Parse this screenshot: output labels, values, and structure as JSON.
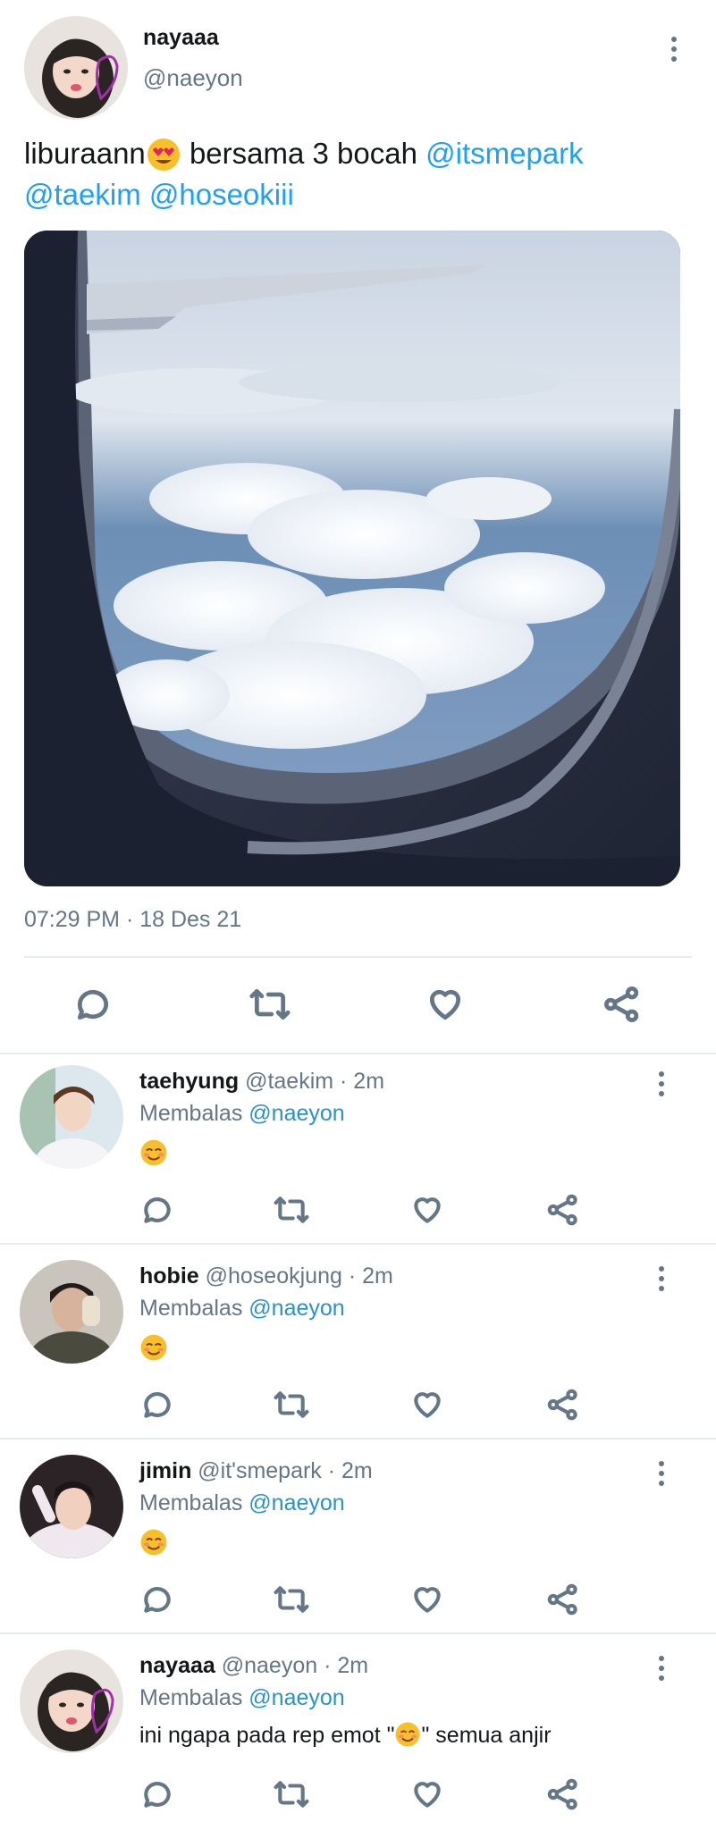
{
  "tweet": {
    "display_name": "nayaaa",
    "handle": "@naeyon",
    "text_plain": "liburaann",
    "text_after_emoji": " bersama 3 bocah ",
    "mention_1": "@itsmepark",
    "mention_2": "@taekim",
    "mention_3": "@hoseokiii",
    "timestamp": "07:29 PM · 18 Des 21",
    "avatar_icon": "profile-photo-nayaaa",
    "media_description_icon": "airplane-window-photo"
  },
  "actions": {
    "reply_icon": "reply-icon",
    "retweet_icon": "retweet-icon",
    "like_icon": "heart-icon",
    "share_icon": "share-icon"
  },
  "replies": [
    {
      "display_name": "taehyung",
      "meta": "@taekim · 2m",
      "replying_label": "Membalas",
      "replying_to": "@naeyon",
      "content": "😊"
    },
    {
      "display_name": "hobie",
      "meta": "@hoseokjung · 2m",
      "replying_label": "Membalas",
      "replying_to": "@naeyon",
      "content": "😊"
    },
    {
      "display_name": "jimin",
      "meta": "@it'smepark · 2m",
      "replying_label": "Membalas",
      "replying_to": "@naeyon",
      "content": "😊"
    },
    {
      "display_name": "nayaaa",
      "meta": "@naeyon · 2m",
      "replying_label": "Membalas",
      "replying_to": "@naeyon",
      "content_before": "ini ngapa pada rep emot \"",
      "content_emoji": "😊",
      "content_after": "\" semua anjir"
    }
  ],
  "colors": {
    "mention": "#1da1f2",
    "muted": "#657786",
    "divider": "#e6ecf0",
    "emoji_face": "#f7c02b",
    "heart_eyes": "#e0245e"
  }
}
